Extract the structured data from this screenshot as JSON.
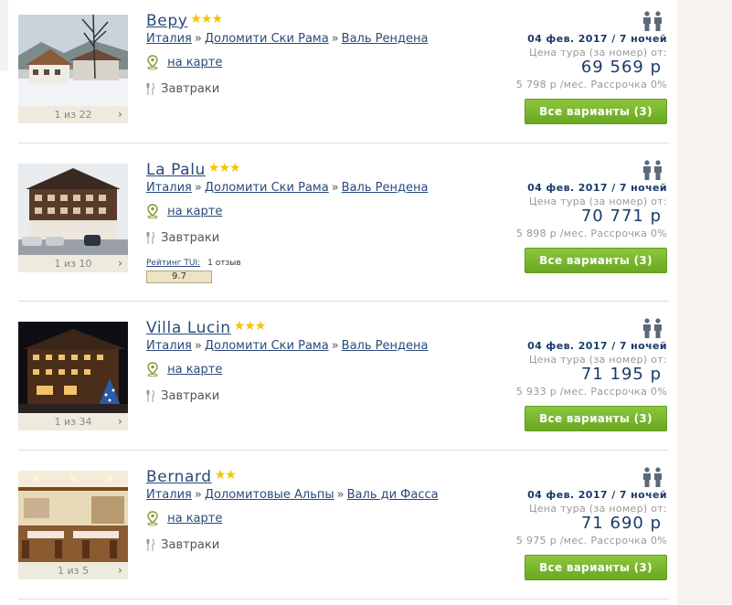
{
  "hotels": [
    {
      "name": "Bepy",
      "stars": "★★★",
      "country": "Италия",
      "region": "Доломити Ски Рама",
      "resort": "Валь Рендена",
      "map_link": "на карте",
      "meal": "Завтраки",
      "photo_counter": "1 из 22",
      "date": "04 фев. 2017 / 7 ночей",
      "price_label": "Цена тура (за номер) от:",
      "price": "69 569 р",
      "installment": "5 798 р /мес. Рассрочка 0%",
      "button": "Все варианты (3)"
    },
    {
      "name": "La Palu",
      "stars": "★★★",
      "country": "Италия",
      "region": "Доломити Ски Рама",
      "resort": "Валь Рендена",
      "map_link": "на карте",
      "meal": "Завтраки",
      "photo_counter": "1 из 10",
      "rating_label": "Рейтинг TUI:",
      "rating_count": "1 отзыв",
      "rating_value": "9.7",
      "date": "04 фев. 2017 / 7 ночей",
      "price_label": "Цена тура (за номер) от:",
      "price": "70 771 р",
      "installment": "5 898 р /мес. Рассрочка 0%",
      "button": "Все варианты (3)"
    },
    {
      "name": "Villa Lucin",
      "stars": "★★★",
      "country": "Италия",
      "region": "Доломити Ски Рама",
      "resort": "Валь Рендена",
      "map_link": "на карте",
      "meal": "Завтраки",
      "photo_counter": "1 из 34",
      "date": "04 фев. 2017 / 7 ночей",
      "price_label": "Цена тура (за номер) от:",
      "price": "71 195 р",
      "installment": "5 933 р /мес. Рассрочка 0%",
      "button": "Все варианты (3)"
    },
    {
      "name": "Bernard",
      "stars": "★★",
      "country": "Италия",
      "region": "Доломитовые Альпы",
      "resort": "Валь ди Фасса",
      "map_link": "на карте",
      "meal": "Завтраки",
      "photo_counter": "1 из 5",
      "date": "04 фев. 2017 / 7 ночей",
      "price_label": "Цена тура (за номер) от:",
      "price": "71 690 р",
      "installment": "5 975 р /мес. Рассрочка 0%",
      "button": "Все варианты (3)"
    }
  ],
  "icons": {
    "photo_next": "chevron-right-icon",
    "map": "map-pin-icon",
    "meal": "fork-knife-icon",
    "people": "two-people-icon"
  },
  "colors": {
    "link": "#2a4a7a",
    "price": "#1a3a6a",
    "star": "#f5c400",
    "button": "#7ab62f"
  }
}
